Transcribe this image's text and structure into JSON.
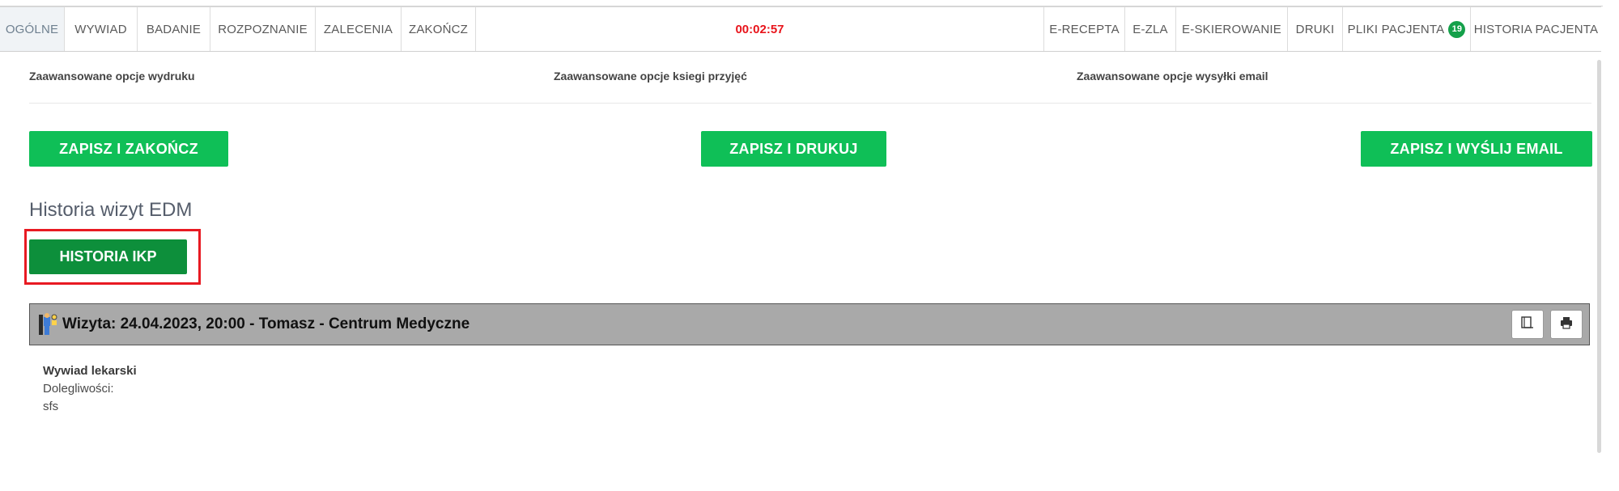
{
  "nav": {
    "left_tabs": [
      {
        "label": "OGÓLNE",
        "active": true
      },
      {
        "label": "WYWIAD",
        "active": false
      },
      {
        "label": "BADANIE",
        "active": false
      },
      {
        "label": "ROZPOZNANIE",
        "active": false
      },
      {
        "label": "ZALECENIA",
        "active": false
      },
      {
        "label": "ZAKOŃCZ",
        "active": false
      }
    ],
    "timer": "00:02:57",
    "right_tabs": [
      {
        "label": "E-RECEPTA"
      },
      {
        "label": "E-ZLA"
      },
      {
        "label": "E-SKIEROWANIE"
      },
      {
        "label": "DRUKI"
      },
      {
        "label": "PLIKI PACJENTA",
        "badge": "19"
      },
      {
        "label": "HISTORIA PACJENTA"
      }
    ]
  },
  "advanced": {
    "print": "Zaawansowane opcje wydruku",
    "admissions_book": "Zaawansowane opcje ksiegi przyjęć",
    "email": "Zaawansowane opcje wysyłki email"
  },
  "actions": {
    "save_finish": "ZAPISZ I ZAKOŃCZ",
    "save_print": "ZAPISZ I DRUKUJ",
    "save_email": "ZAPISZ I WYŚLIJ EMAIL"
  },
  "history": {
    "title": "Historia wizyt EDM",
    "ikp_button": "HISTORIA IKP"
  },
  "visit": {
    "title": "Wizyta: 24.04.2023, 20:00 - Tomasz - Centrum Medyczne",
    "icons": [
      "copy-icon",
      "print-icon"
    ]
  },
  "details": {
    "heading": "Wywiad lekarski",
    "field_label": "Dolegliwości:",
    "field_value": "sfs"
  },
  "colors": {
    "primary_green": "#0fbf57",
    "dark_green": "#0d8f3b",
    "timer_red": "#e8141b",
    "highlight_red": "#e81a22",
    "visit_bar_gray": "#a9a9a9"
  }
}
